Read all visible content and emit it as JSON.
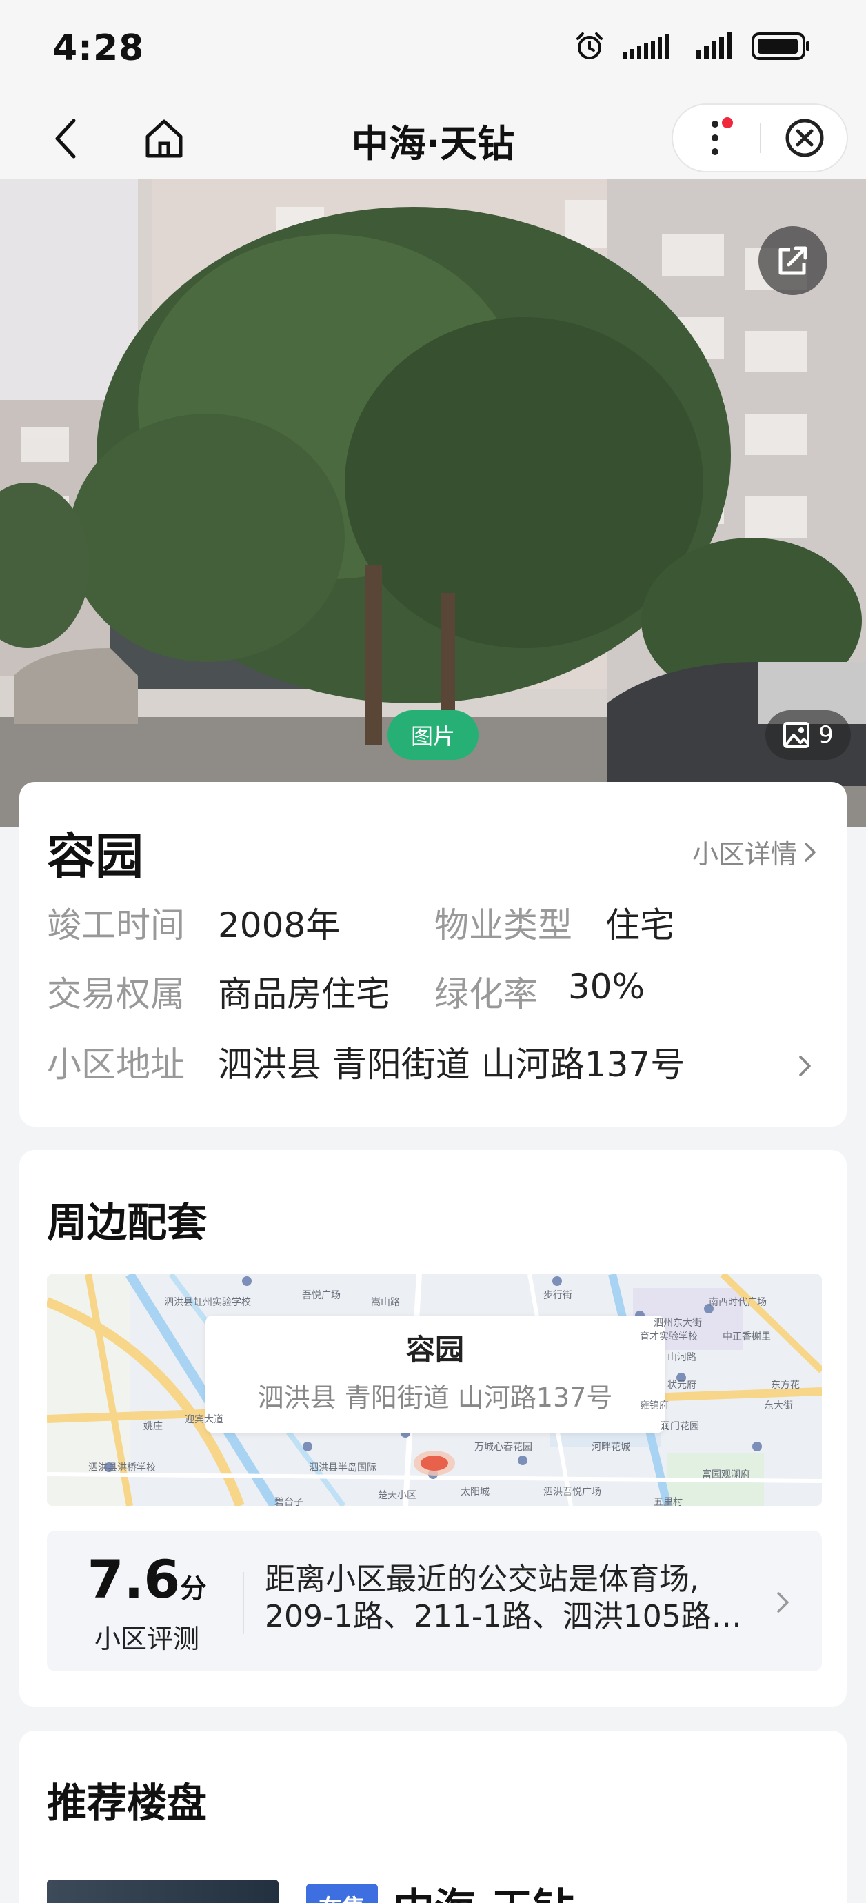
{
  "status_bar": {
    "time": "4:28",
    "icons": [
      "alarm-icon",
      "signal-icon",
      "signal-icon",
      "battery-icon"
    ]
  },
  "nav": {
    "title": "中海·天钻"
  },
  "hero": {
    "picture_tag": "图片",
    "photo_count": "9"
  },
  "estate": {
    "name": "容园",
    "detail_link": "小区详情",
    "rows": {
      "completion_label": "竣工时间",
      "completion_value": "2008年",
      "property_type_label": "物业类型",
      "property_type_value": "住宅",
      "ownership_label": "交易权属",
      "ownership_value": "商品房住宅",
      "greening_label": "绿化率",
      "greening_value": "30%",
      "address_label": "小区地址",
      "address_value": "泗洪县 青阳街道 山河路137号"
    }
  },
  "surroundings": {
    "title": "周边配套",
    "map_popup": {
      "name": "容园",
      "address": "泗洪县 青阳街道 山河路137号"
    },
    "map_labels": [
      "泗洪县虹州实验学校",
      "吾悦广场",
      "嵩山路",
      "步行街",
      "南西时代广场",
      "泗州东大街",
      "育才实验学校",
      "中正香榭里",
      "山河路",
      "状元府",
      "东方花",
      "雍锦府",
      "润门花园",
      "东大街",
      "泗洪县洪桥学校",
      "泗洪县半岛国际",
      "万城心春花园",
      "河畔花城",
      "富园观澜府",
      "五里村",
      "太阳城",
      "泗洪吾悦广场",
      "迎宾大道",
      "姚庄",
      "楚天小区",
      "碧台子"
    ],
    "score": "7.6",
    "score_unit": "分",
    "score_label": "小区评测",
    "bus_info": "距离小区最近的公交站是体育场, 209-1路、211-1路、泗洪105路…"
  },
  "recommend": {
    "title": "推荐楼盘",
    "items": [
      {
        "tag": "在售",
        "name": "中海·天钻"
      }
    ]
  },
  "colors": {
    "accent_green": "#27b075",
    "tag_blue": "#3d6fe0",
    "notify_red": "#f0283c",
    "page_bg": "#f3f4f6"
  }
}
